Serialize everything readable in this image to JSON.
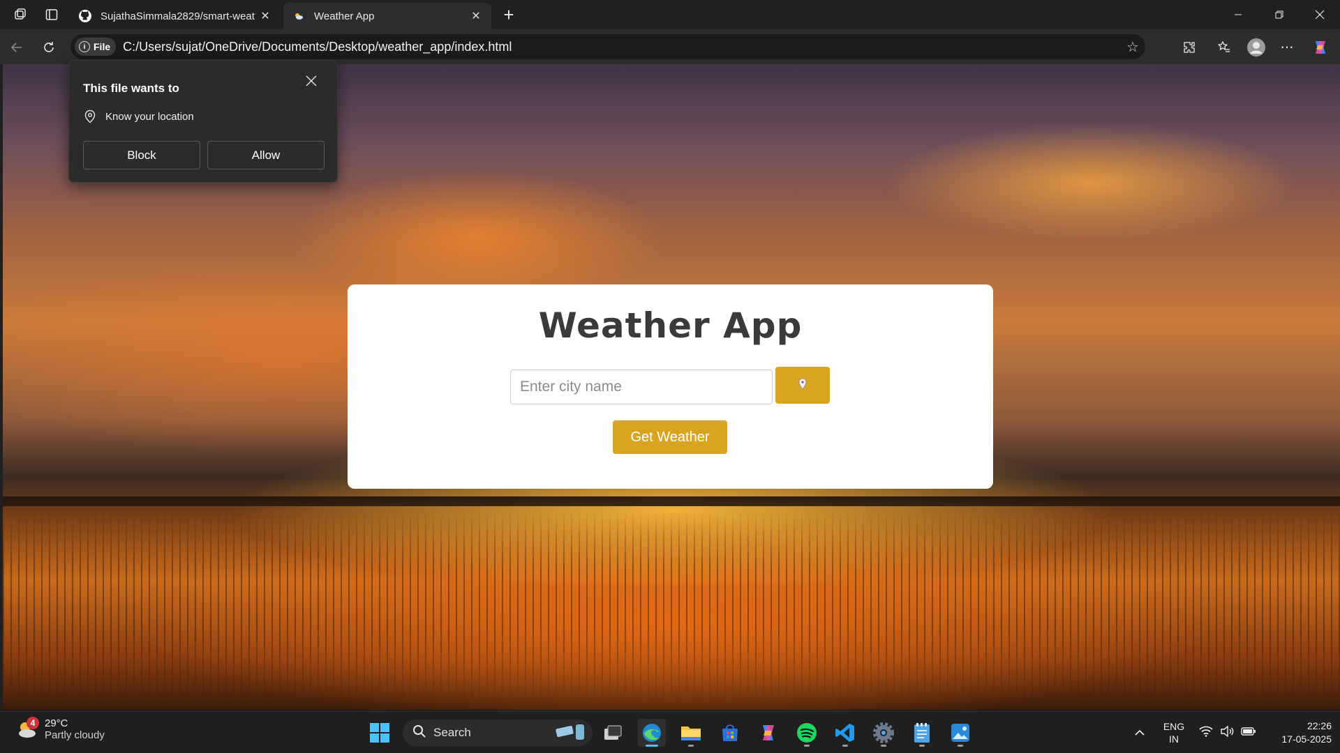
{
  "browser": {
    "tabs": [
      {
        "title": "SujathaSimmala2829/smart-weat",
        "favicon": "github-icon",
        "active": false
      },
      {
        "title": "Weather App",
        "favicon": "weather-app-icon",
        "active": true
      }
    ],
    "address": {
      "chip_label": "File",
      "url": "C:/Users/sujat/OneDrive/Documents/Desktop/weather_app/index.html"
    }
  },
  "permission_prompt": {
    "title": "This file wants to",
    "request": "Know your location",
    "block_label": "Block",
    "allow_label": "Allow"
  },
  "app": {
    "title": "Weather App",
    "city_placeholder": "Enter city name",
    "city_value": "",
    "location_button_icon": "location-pin-icon",
    "get_weather_label": "Get Weather",
    "accent_color": "#d9a520"
  },
  "taskbar": {
    "weather": {
      "temp": "29°C",
      "condition": "Partly cloudy",
      "badge": "4"
    },
    "search_label": "Search",
    "language": {
      "line1": "ENG",
      "line2": "IN"
    },
    "clock": {
      "time": "22:26",
      "date": "17-05-2025"
    },
    "pinned_apps": [
      "windows-start-icon",
      "search-icon",
      "task-view-icon",
      "edge-icon",
      "file-explorer-icon",
      "microsoft-store-icon",
      "copilot-icon",
      "spotify-icon",
      "vscode-icon",
      "settings-icon",
      "notepad-icon",
      "photos-icon"
    ]
  }
}
